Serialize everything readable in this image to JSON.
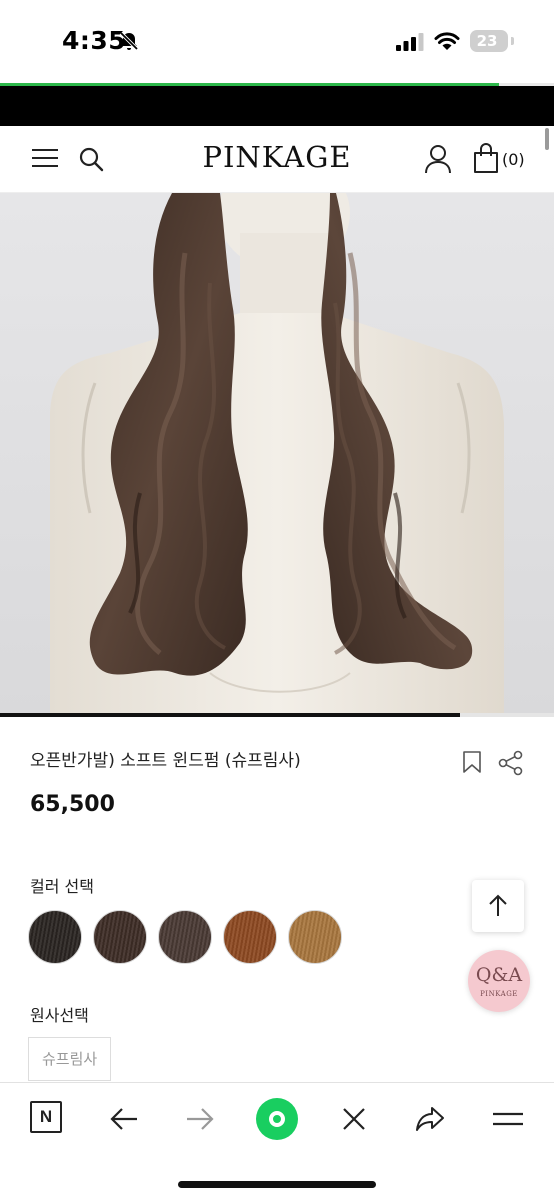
{
  "status_bar": {
    "time": "4:35",
    "battery": "23",
    "icons": [
      "bell-slash-icon",
      "signal-icon",
      "wifi-icon",
      "battery-icon"
    ]
  },
  "page_load_progress": 0.9,
  "header": {
    "logo": "PINKAGE",
    "cart_count": "(0)",
    "icons": [
      "hamburger-menu-icon",
      "search-icon",
      "user-icon",
      "shopping-bag-icon"
    ]
  },
  "gallery": {
    "image": "long wavy brown hair wig on mannequin",
    "slide_progress": 0.83
  },
  "product": {
    "title": "오픈반가발) 소프트 윈드펌 (슈프림사)",
    "price": "65,500"
  },
  "color_section": {
    "label": "컬러 선택",
    "swatches": [
      {
        "color": "#2a2522"
      },
      {
        "color": "#3e2d26"
      },
      {
        "color": "#4a3a34"
      },
      {
        "color": "#8e4a22"
      },
      {
        "color": "#a9773f"
      }
    ]
  },
  "material_section": {
    "label": "원사선택",
    "options": [
      "슈프림사"
    ]
  },
  "floating": {
    "qa_label": "Q&A",
    "qa_sub": "PINKAGE"
  },
  "bottom_bar": {
    "n_label": "N",
    "icons": [
      "naver-n-icon",
      "back-arrow-icon",
      "forward-arrow-icon",
      "green-home-icon",
      "close-icon",
      "share-arrow-icon",
      "menu-icon"
    ]
  },
  "colors": {
    "accent_green": "#19ce60",
    "progress_green": "#2db84b",
    "qa_pink": "#f5c9cf"
  }
}
